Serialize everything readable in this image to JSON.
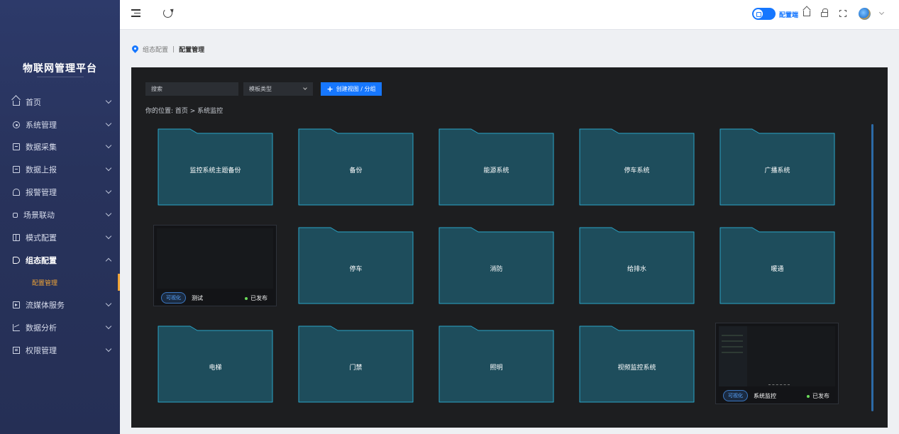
{
  "sidebar": {
    "logo": "物联网管理平台",
    "items": [
      {
        "label": "首页"
      },
      {
        "label": "系统管理"
      },
      {
        "label": "数据采集"
      },
      {
        "label": "数据上报"
      },
      {
        "label": "报警管理"
      },
      {
        "label": "场景联动"
      },
      {
        "label": "模式配置"
      },
      {
        "label": "组态配置"
      },
      {
        "label": "流媒体服务"
      },
      {
        "label": "数据分析"
      },
      {
        "label": "权限管理"
      }
    ],
    "sub_item": "配置管理"
  },
  "header": {
    "toggle_label": "配置端"
  },
  "breadcrumb": {
    "parent": "组态配置",
    "separator": "|",
    "current": "配置管理"
  },
  "toolbar": {
    "search_placeholder": "搜索",
    "select_value": "模板类型",
    "create_label": "创建视图 / 分组"
  },
  "path": "你的位置:  首页   >   系统监控",
  "folders": {
    "r1c1": "监控系统主题备份",
    "r1c2": "备份",
    "r1c3": "能源系统",
    "r1c4": "停车系统",
    "r1c5": "广播系统",
    "r2c2": "停车",
    "r2c3": "消防",
    "r2c4": "给排水",
    "r2c5": "暖通",
    "r3c1": "电梯",
    "r3c2": "门禁",
    "r3c3": "照明",
    "r3c4": "视频监控系统"
  },
  "cards": [
    {
      "badge": "可视化",
      "name": "测试",
      "status": "已发布"
    },
    {
      "badge": "可视化",
      "name": "系统监控",
      "status": "已发布"
    }
  ],
  "colors": {
    "accent": "#1677ff",
    "active_menu": "#f0a437",
    "folder_fill": "#1e4d5c",
    "folder_border": "#2aa5c8",
    "published_dot": "#6bdc5a"
  }
}
